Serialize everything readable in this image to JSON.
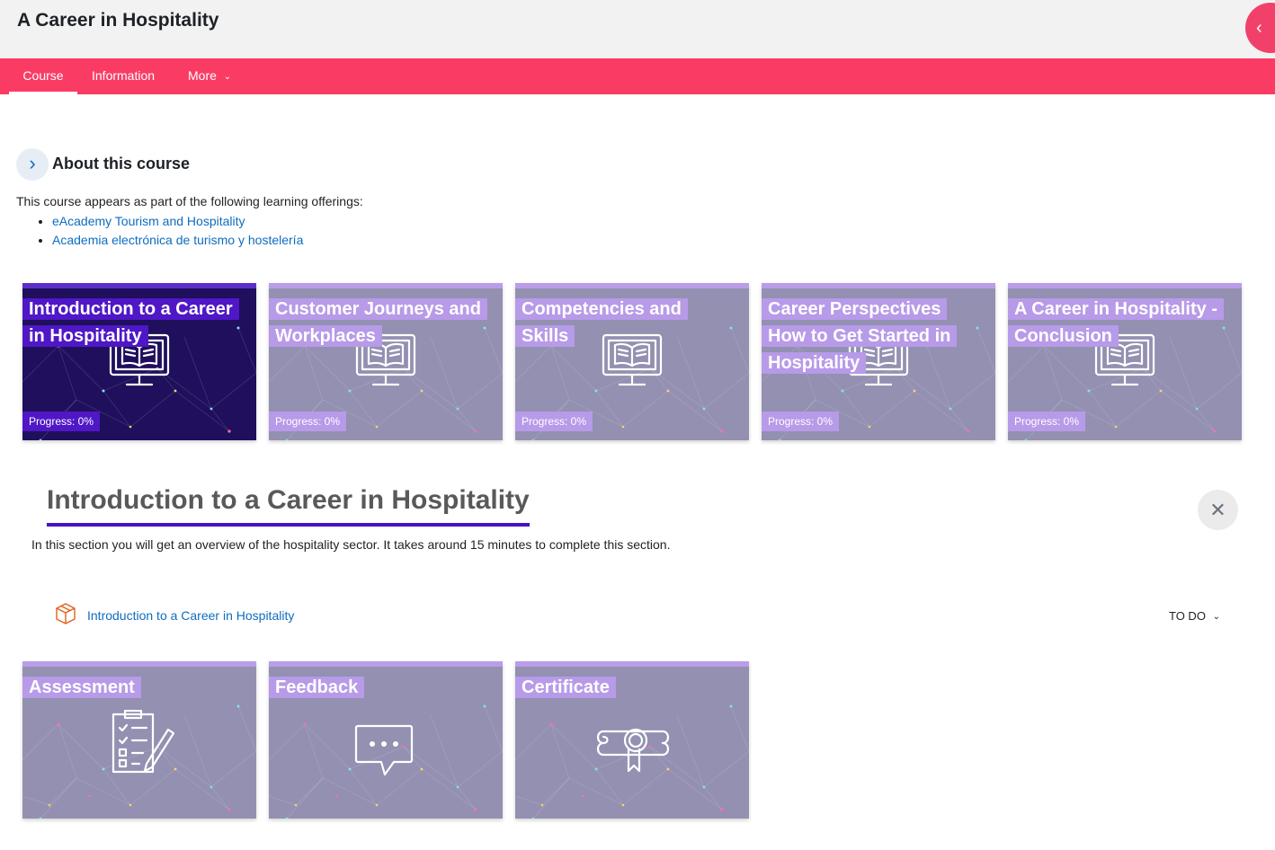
{
  "header": {
    "title": "A Career in Hospitality",
    "drawer_icon": "chevron-left-icon"
  },
  "nav": {
    "items": [
      {
        "label": "Course",
        "active": true
      },
      {
        "label": "Information",
        "active": false
      },
      {
        "label": "More",
        "dropdown": true
      }
    ]
  },
  "about": {
    "title": "About this course",
    "intro": "This course appears as part of the following learning offerings:",
    "offerings": [
      "eAcademy Tourism and Hospitality",
      "Academia electrónica de turismo y hostelería"
    ]
  },
  "sections": [
    {
      "title": "Introduction to a Career in Hospitality",
      "progress": "Progress: 0%",
      "icon": "computer-book-icon",
      "active": true
    },
    {
      "title": "Customer Journeys and Workplaces",
      "progress": "Progress: 0%",
      "icon": "computer-book-icon"
    },
    {
      "title": "Competencies and Skills",
      "progress": "Progress: 0%",
      "icon": "computer-book-icon"
    },
    {
      "title": "Career Perspectives How to Get Started in Hospitality",
      "progress": "Progress: 0%",
      "icon": "computer-book-icon"
    },
    {
      "title": "A Career in Hospitality - Conclusion",
      "progress": "Progress: 0%",
      "icon": "computer-book-icon"
    }
  ],
  "selected_section": {
    "title": "Introduction to a Career in Hospitality",
    "summary": "In this section you will get an overview of the hospitality sector. It takes around 15 minutes to complete this section.",
    "activity": {
      "label": "Introduction to a Career in Hospitality",
      "icon": "package-icon",
      "status": "TO DO"
    },
    "close_icon": "close-icon"
  },
  "extra_sections": [
    {
      "title": "Assessment",
      "icon": "checklist-icon"
    },
    {
      "title": "Feedback",
      "icon": "chat-bubble-icon"
    },
    {
      "title": "Certificate",
      "icon": "certificate-icon"
    }
  ],
  "colors": {
    "nav_bar": "#fa3c64",
    "card_bg": "#9390b1",
    "card_label": "#b79ae8",
    "active_card_bg": "#1f0f5c",
    "active_label": "#4f17c6",
    "link": "#0f6cbf"
  }
}
